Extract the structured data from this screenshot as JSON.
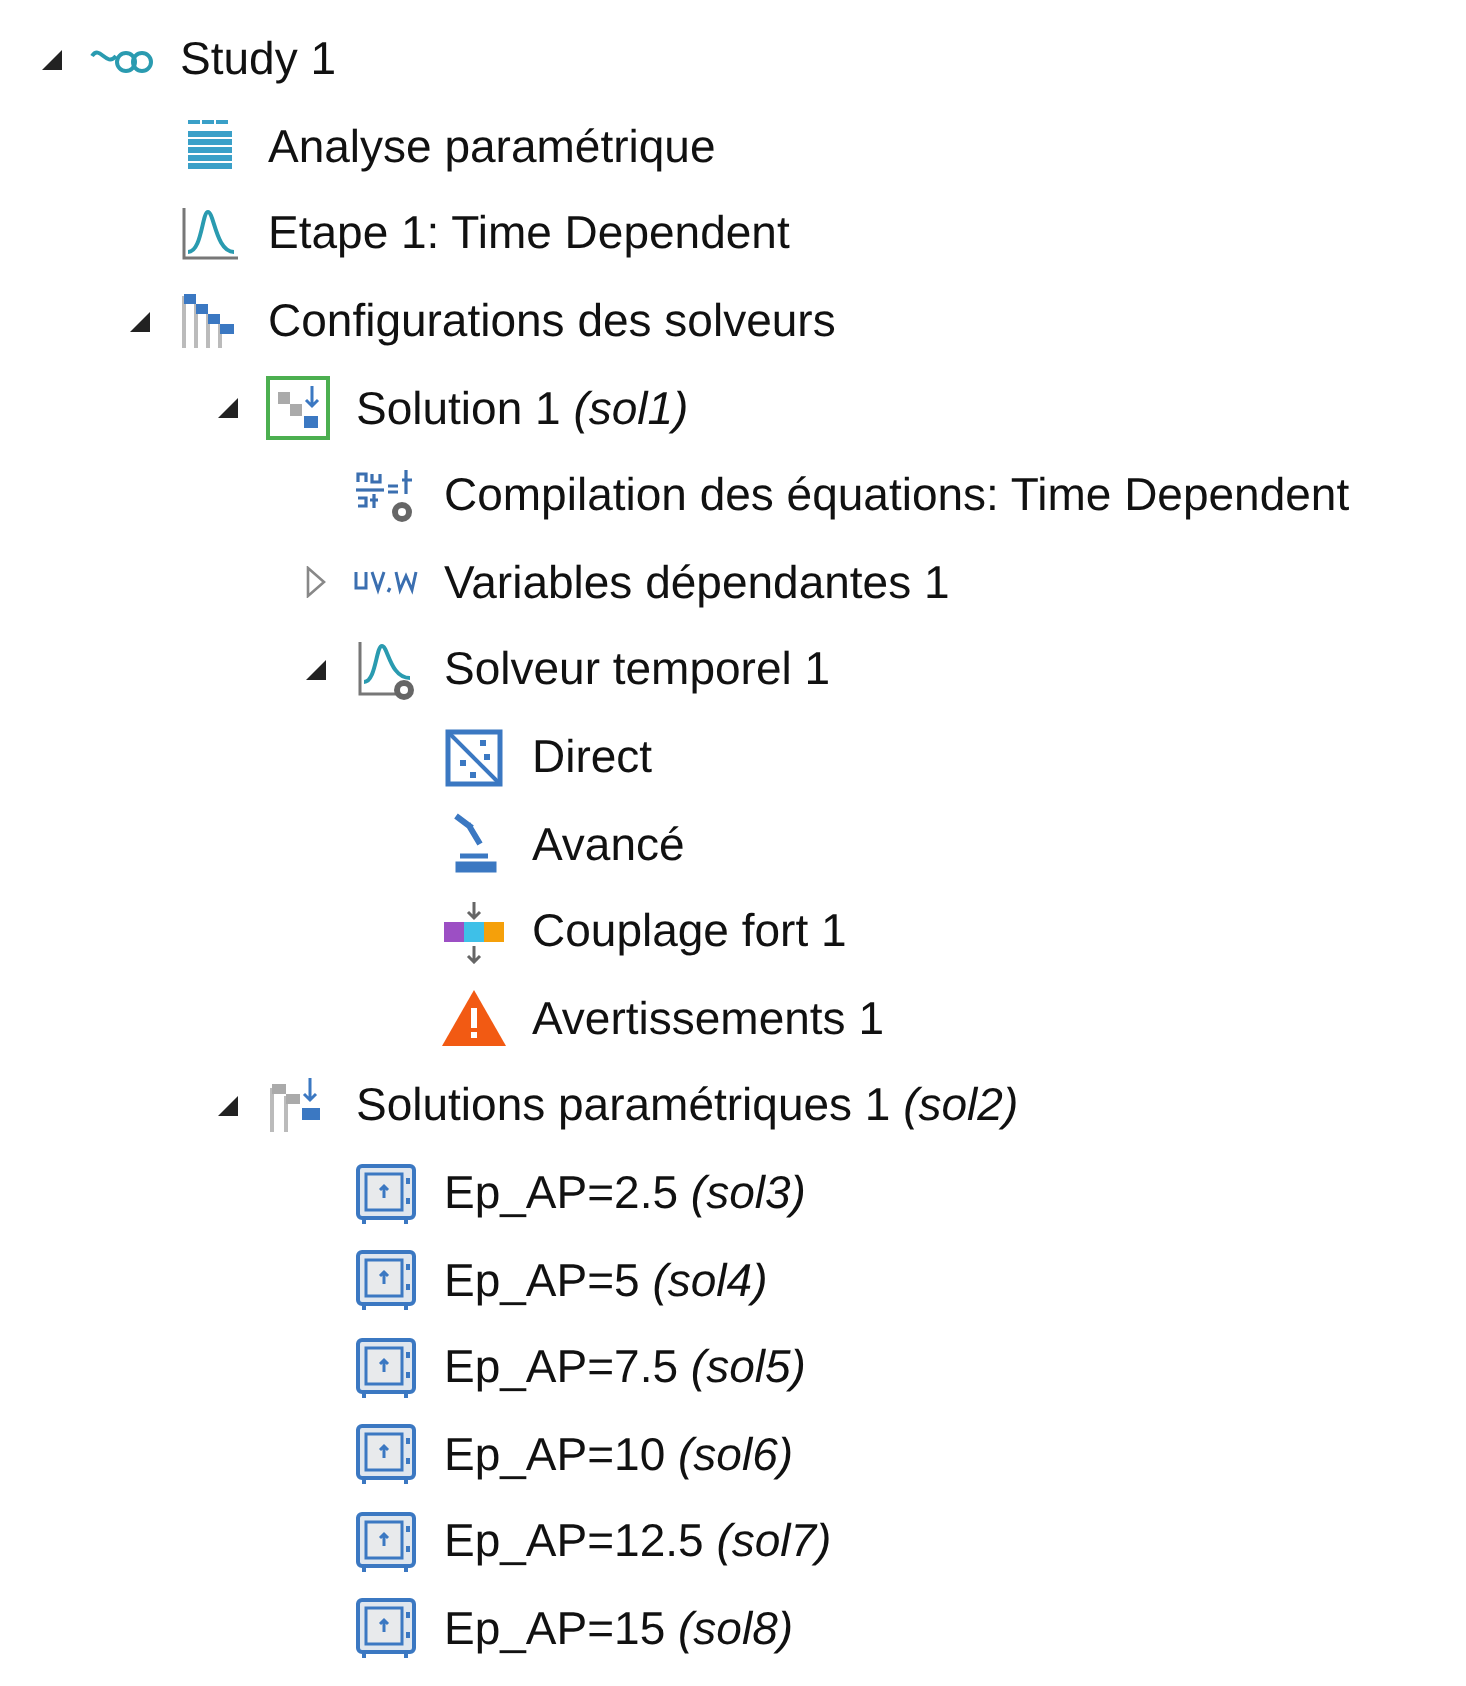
{
  "tree": [
    {
      "kind": "study",
      "label": "Study 1",
      "expanded": true,
      "children": [
        {
          "kind": "parametric",
          "label": "Analyse paramétrique"
        },
        {
          "kind": "step",
          "label": "Etape 1: Time Dependent"
        },
        {
          "kind": "solver-configs",
          "label": "Configurations des solveurs",
          "expanded": true,
          "children": [
            {
              "kind": "solution",
              "label": "Solution 1 *(sol1)*",
              "expanded": true,
              "children": [
                {
                  "kind": "compile",
                  "label": "Compilation des équations: Time Dependent"
                },
                {
                  "kind": "variables",
                  "label": "Variables dépendantes 1",
                  "expanded": false
                },
                {
                  "kind": "time-solver",
                  "label": "Solveur temporel 1",
                  "expanded": true,
                  "children": [
                    {
                      "kind": "direct",
                      "label": "Direct"
                    },
                    {
                      "kind": "advanced",
                      "label": "Avancé"
                    },
                    {
                      "kind": "coupling",
                      "label": "Couplage fort 1"
                    },
                    {
                      "kind": "warning",
                      "label": "Avertissements 1"
                    }
                  ]
                }
              ]
            },
            {
              "kind": "param-solutions",
              "label": "Solutions paramétriques 1 *(sol2)*",
              "expanded": true,
              "children": [
                {
                  "kind": "stored",
                  "label": "Ep_AP=2.5 *(sol3)*"
                },
                {
                  "kind": "stored",
                  "label": "Ep_AP=5 *(sol4)*"
                },
                {
                  "kind": "stored",
                  "label": "Ep_AP=7.5 *(sol5)*"
                },
                {
                  "kind": "stored",
                  "label": "Ep_AP=10 *(sol6)*"
                },
                {
                  "kind": "stored",
                  "label": "Ep_AP=12.5 *(sol7)*"
                },
                {
                  "kind": "stored",
                  "label": "Ep_AP=15 *(sol8)*"
                }
              ]
            }
          ]
        }
      ]
    }
  ]
}
